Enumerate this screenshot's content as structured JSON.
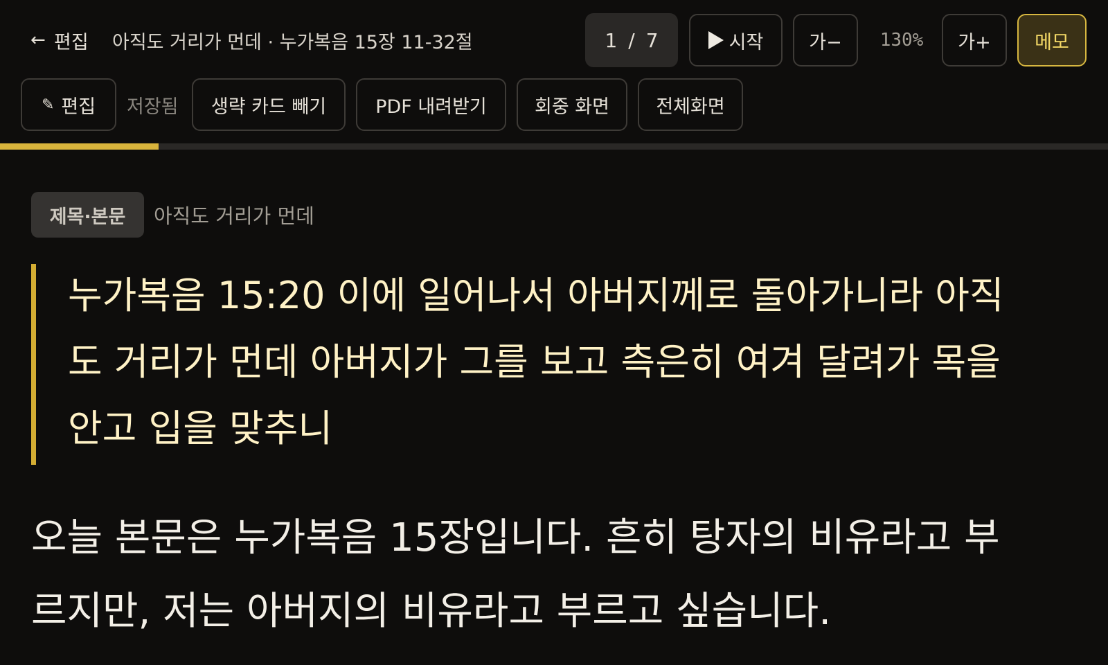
{
  "header": {
    "back_label": "편집",
    "doc_title": "아직도 거리가 먼데 · 누가복음 15장 11-32절",
    "page_current": "1",
    "page_separator": "/",
    "page_total": "7",
    "start_label": "시작",
    "font_minus_label": "가−",
    "zoom_label": "130%",
    "font_plus_label": "가+",
    "memo_label": "메모"
  },
  "toolbar": {
    "edit_label": "편집",
    "saved_label": "저장됨",
    "cards_label": "생략 카드 빼기",
    "pdf_label": "PDF 내려받기",
    "audience_label": "회중 화면",
    "fullscreen_label": "전체화면"
  },
  "progress": {
    "fraction": 0.143
  },
  "content": {
    "section_tag": "제목·본문",
    "section_title": "아직도 거리가 먼데",
    "scripture": "누가복음 15:20 이에 일어나서 아버지께로 돌아가니라 아직도 거리가 먼데 아버지가 그를 보고 측은히 여겨 달려가 목을 안고 입을 맞추니",
    "body": "오늘 본문은 누가복음 15장입니다. 흔히 탕자의 비유라고 부르지만, 저는 아버지의 비유라고 부르고 싶습니다."
  },
  "icons": {
    "back": "arrow-left-icon",
    "play": "play-icon",
    "edit": "pencil-icon"
  },
  "colors": {
    "background": "#0e0d0c",
    "accent": "#d9b43c",
    "memo_text": "#f3d866",
    "scripture_text": "#fff2c6"
  }
}
